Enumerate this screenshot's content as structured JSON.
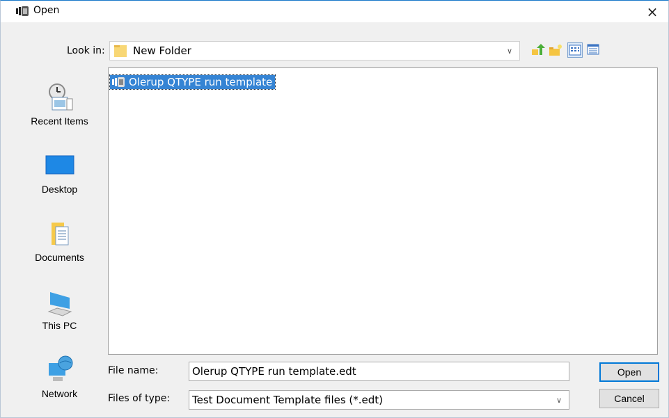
{
  "window": {
    "title": "Open",
    "close_glyph": "×"
  },
  "toolbar": {
    "look_in_label": "Look in:",
    "look_in_value": "New Folder",
    "buttons": [
      {
        "name": "up-one-level-icon"
      },
      {
        "name": "new-folder-icon"
      },
      {
        "name": "list-view-icon"
      },
      {
        "name": "details-view-icon"
      }
    ]
  },
  "places": [
    {
      "label": "Recent Items",
      "icon": "recent-items-icon"
    },
    {
      "label": "Desktop",
      "icon": "desktop-icon"
    },
    {
      "label": "Documents",
      "icon": "documents-icon"
    },
    {
      "label": "This PC",
      "icon": "this-pc-icon"
    },
    {
      "label": "Network",
      "icon": "network-icon"
    }
  ],
  "files": [
    {
      "name": "Olerup QTYPE run template",
      "selected": true
    }
  ],
  "form": {
    "file_name_label": "File name:",
    "file_name_value": "Olerup QTYPE run template.edt",
    "file_type_label": "Files of type:",
    "file_type_value": "Test Document Template files (*.edt)"
  },
  "actions": {
    "open_label": "Open",
    "cancel_label": "Cancel"
  },
  "colors": {
    "selection": "#3584d4",
    "accent": "#0078d7"
  }
}
